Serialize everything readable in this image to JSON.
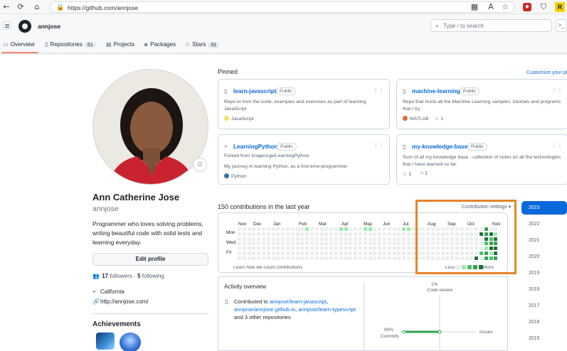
{
  "browser": {
    "url": "https://github.com/annjose"
  },
  "header": {
    "username": "annjose",
    "search_placeholder": "Type / to search"
  },
  "tabs": [
    {
      "label": "Overview",
      "count": ""
    },
    {
      "label": "Repositories",
      "count": "51"
    },
    {
      "label": "Projects",
      "count": ""
    },
    {
      "label": "Packages",
      "count": ""
    },
    {
      "label": "Stars",
      "count": "31"
    }
  ],
  "profile": {
    "full_name": "Ann Catherine Jose",
    "login": "annjose",
    "bio": "Programmer who loves solving problems, writing beautiful code with solid tests and learning everyday.",
    "edit_label": "Edit profile",
    "followers": "17",
    "followers_label": "followers",
    "following": "5",
    "following_label": "following",
    "location": "California",
    "website": "http://annjose.com/",
    "achievements_title": "Achievements"
  },
  "pinned": {
    "title": "Pinned",
    "customize": "Customize your pins",
    "cards": [
      {
        "name": "learn-javascript",
        "visibility": "Public",
        "forked": "",
        "desc": "Repo to host the code, examples and exercises as part of learning JavaScript",
        "lang": "JavaScript",
        "lang_color": "#f1e05a",
        "stars": "",
        "forks": ""
      },
      {
        "name": "machine-learning",
        "visibility": "Public",
        "forked": "",
        "desc": "Repo that hosts all the Machine Learning samples, tutorials and programs that I try",
        "lang": "MATLAB",
        "lang_color": "#e16737",
        "stars": "1",
        "forks": ""
      },
      {
        "name": "LearningPython",
        "visibility": "Public",
        "forked": "Forked from lizageorge/LearningPython",
        "desc": "My journey in learning Python, as a first-time-programmer",
        "lang": "Python",
        "lang_color": "#3572A5",
        "stars": "",
        "forks": ""
      },
      {
        "name": "my-knowledge-base",
        "visibility": "Public",
        "forked": "",
        "desc": "Sum of all my knowledge base - collection of notes on all the technologies that I have learned so far.",
        "lang": "",
        "lang_color": "",
        "stars": "1",
        "forks": "1"
      }
    ]
  },
  "contributions": {
    "title": "150 contributions in the last year",
    "settings": "Contribution settings ▾",
    "months": [
      "Nov",
      "Dec",
      "Jan",
      "Feb",
      "Mar",
      "Apr",
      "May",
      "Jun",
      "Jul",
      "Aug",
      "Sep",
      "Oct",
      "Nov"
    ],
    "day_labels": [
      "Mon",
      "Wed",
      "Fri"
    ],
    "learn": "Learn how we count contributions",
    "less": "Less",
    "more": "More",
    "legend_colors": [
      "#ebedf0",
      "#9be9a8",
      "#40c463",
      "#30a14e",
      "#216e39"
    ],
    "cells": [
      {
        "week": 14,
        "day": 0,
        "level": 1
      },
      {
        "week": 21,
        "day": 0,
        "level": 1
      },
      {
        "week": 22,
        "day": 0,
        "level": 1
      },
      {
        "week": 26,
        "day": 0,
        "level": 1
      },
      {
        "week": 27,
        "day": 0,
        "level": 1
      },
      {
        "week": 34,
        "day": 0,
        "level": 1
      },
      {
        "week": 35,
        "day": 0,
        "level": 1
      },
      {
        "week": 50,
        "day": 1,
        "level": 4
      },
      {
        "week": 51,
        "day": 0,
        "level": 3
      },
      {
        "week": 51,
        "day": 1,
        "level": 3
      },
      {
        "week": 51,
        "day": 2,
        "level": 4
      },
      {
        "week": 51,
        "day": 3,
        "level": 2
      },
      {
        "week": 51,
        "day": 4,
        "level": 1
      },
      {
        "week": 51,
        "day": 5,
        "level": 3
      },
      {
        "week": 51,
        "day": 6,
        "level": 3
      },
      {
        "week": 52,
        "day": 1,
        "level": 4
      },
      {
        "week": 52,
        "day": 2,
        "level": 2
      },
      {
        "week": 52,
        "day": 3,
        "level": 3
      },
      {
        "week": 52,
        "day": 4,
        "level": 4
      },
      {
        "week": 52,
        "day": 5,
        "level": 1
      },
      {
        "week": 52,
        "day": 6,
        "level": 2
      },
      {
        "week": 53,
        "day": 1,
        "level": 1
      },
      {
        "week": 53,
        "day": 2,
        "level": 4
      },
      {
        "week": 53,
        "day": 3,
        "level": 3
      },
      {
        "week": 53,
        "day": 4,
        "level": 4
      },
      {
        "week": 53,
        "day": 5,
        "level": 4
      },
      {
        "week": 53,
        "day": 6,
        "level": 3
      },
      {
        "week": 49,
        "day": 6,
        "level": 4
      },
      {
        "week": 50,
        "day": 5,
        "level": 2
      }
    ]
  },
  "activity": {
    "title": "Activity overview",
    "contributed_to": "Contributed to",
    "repos": [
      "annjose/learn-javascript",
      "annjose/annjose.github.io",
      "annjose/learn-typescript"
    ],
    "others": "and 3 other repositories",
    "code_review_pct": "1%",
    "code_review_label": "Code review",
    "commits_pct": "99%",
    "commits_label": "Commits",
    "issues_label": "Issues"
  },
  "years": [
    "2023",
    "2022",
    "2021",
    "2020",
    "2019",
    "2018",
    "2017",
    "2016",
    "2015"
  ],
  "colors": {
    "accent": "#0969da",
    "highlight": "#e8832a",
    "tab_underline": "#fd8c73"
  }
}
